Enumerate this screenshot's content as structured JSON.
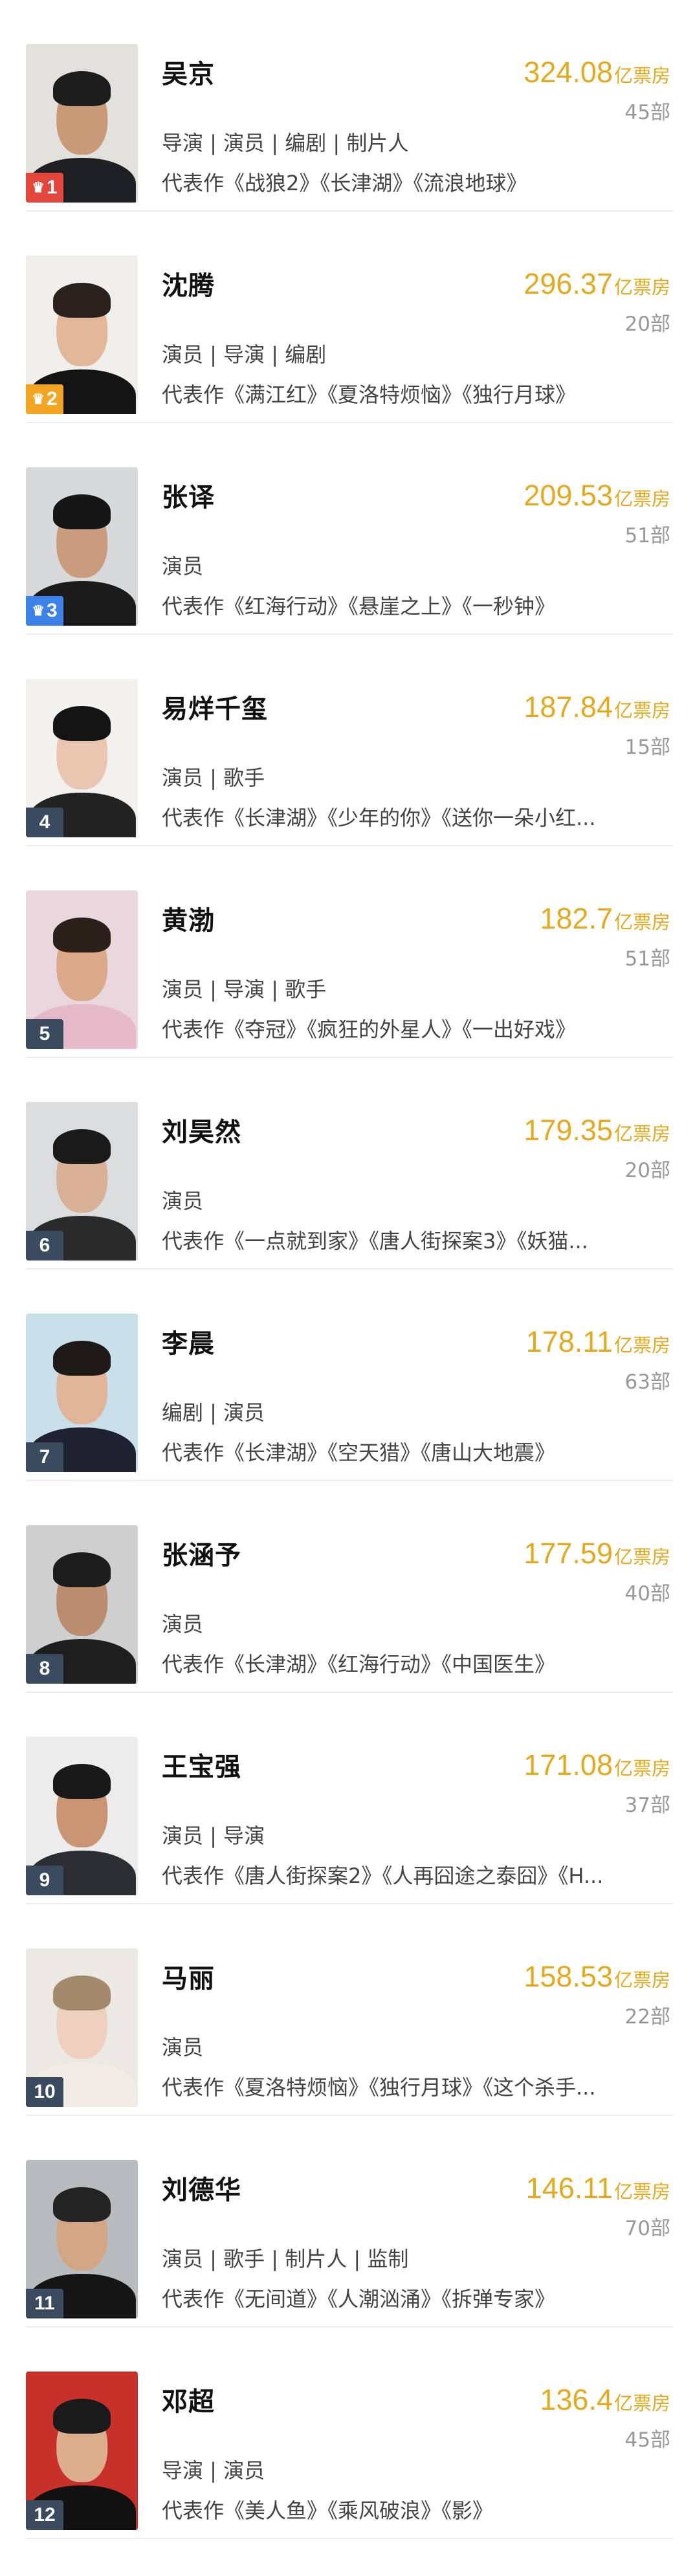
{
  "box_unit": "亿票房",
  "rank_colors": {
    "top": "#e5463b",
    "second": "#f1a522",
    "third": "#3d82e8",
    "rest": "#3a4a5f"
  },
  "accent_color": "#e4a91c",
  "crown_icon": "♛",
  "people": [
    {
      "rank": "1",
      "name": "吴京",
      "box_office": "324.08",
      "films": "45部",
      "roles": "导演 | 演员 | 编剧 | 制片人",
      "works": "代表作《战狼2》《长津湖》《流浪地球》"
    },
    {
      "rank": "2",
      "name": "沈腾",
      "box_office": "296.37",
      "films": "20部",
      "roles": "演员 | 导演 | 编剧",
      "works": "代表作《满江红》《夏洛特烦恼》《独行月球》"
    },
    {
      "rank": "3",
      "name": "张译",
      "box_office": "209.53",
      "films": "51部",
      "roles": "演员",
      "works": "代表作《红海行动》《悬崖之上》《一秒钟》"
    },
    {
      "rank": "4",
      "name": "易烊千玺",
      "box_office": "187.84",
      "films": "15部",
      "roles": "演员 | 歌手",
      "works": "代表作《长津湖》《少年的你》《送你一朵小红..."
    },
    {
      "rank": "5",
      "name": "黄渤",
      "box_office": "182.7",
      "films": "51部",
      "roles": "演员 | 导演 | 歌手",
      "works": "代表作《夺冠》《疯狂的外星人》《一出好戏》"
    },
    {
      "rank": "6",
      "name": "刘昊然",
      "box_office": "179.35",
      "films": "20部",
      "roles": "演员",
      "works": "代表作《一点就到家》《唐人街探案3》《妖猫..."
    },
    {
      "rank": "7",
      "name": "李晨",
      "box_office": "178.11",
      "films": "63部",
      "roles": "编剧 | 演员",
      "works": "代表作《长津湖》《空天猎》《唐山大地震》"
    },
    {
      "rank": "8",
      "name": "张涵予",
      "box_office": "177.59",
      "films": "40部",
      "roles": "演员",
      "works": "代表作《长津湖》《红海行动》《中国医生》"
    },
    {
      "rank": "9",
      "name": "王宝强",
      "box_office": "171.08",
      "films": "37部",
      "roles": "演员 | 导演",
      "works": "代表作《唐人街探案2》《人再囧途之泰囧》《H..."
    },
    {
      "rank": "10",
      "name": "马丽",
      "box_office": "158.53",
      "films": "22部",
      "roles": "演员",
      "works": "代表作《夏洛特烦恼》《独行月球》《这个杀手..."
    },
    {
      "rank": "11",
      "name": "刘德华",
      "box_office": "146.11",
      "films": "70部",
      "roles": "演员 | 歌手 | 制片人 | 监制",
      "works": "代表作《无间道》《人潮汹涌》《拆弹专家》"
    },
    {
      "rank": "12",
      "name": "邓超",
      "box_office": "136.4",
      "films": "45部",
      "roles": "导演 | 演员",
      "works": "代表作《美人鱼》《乘风破浪》《影》"
    }
  ]
}
